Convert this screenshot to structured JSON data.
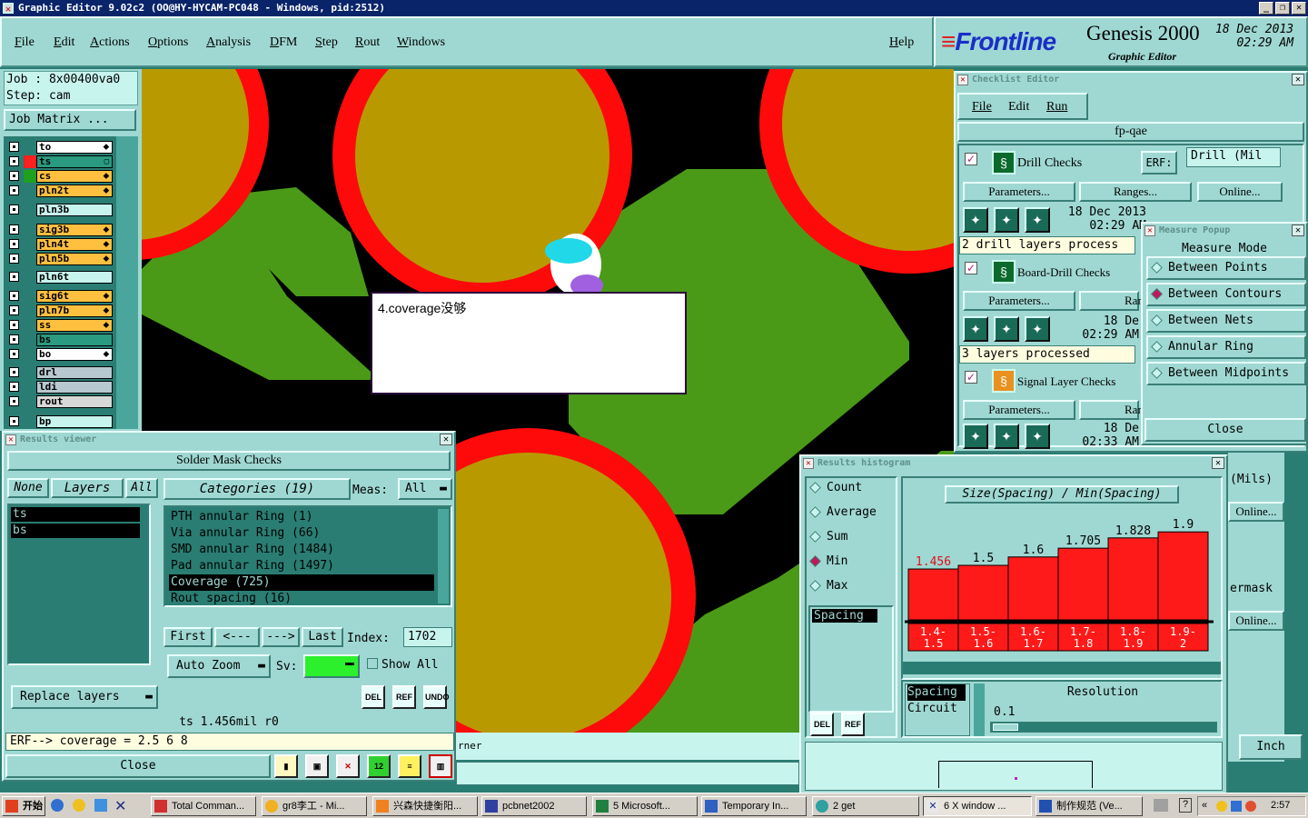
{
  "window": {
    "title": "Graphic Editor 9.02c2 (OO@HY-HYCAM-PC048 - Windows, pid:2512)"
  },
  "menu": [
    "File",
    "Edit",
    "Actions",
    "Options",
    "Analysis",
    "DFM",
    "Step",
    "Rout",
    "Windows"
  ],
  "help": "Help",
  "brand": {
    "logo": "Frontline",
    "product": "Genesis 2000",
    "subtitle": "Graphic Editor",
    "date": "18 Dec 2013",
    "time": "02:29 AM"
  },
  "job": {
    "job_line": "Job : 8x00400va0",
    "step_line": "Step: cam",
    "matrix_button": "Job Matrix ..."
  },
  "layers": [
    {
      "name": "to",
      "color": "#ffffff",
      "swatch": "#2a7d73",
      "mark": "⬥"
    },
    {
      "name": "ts",
      "color": "#2a9a80",
      "swatch": "#ff2020",
      "mark": "▢",
      "active": true
    },
    {
      "name": "cs",
      "color": "#ffc040",
      "swatch": "#1fa01f",
      "mark": "⬥"
    },
    {
      "name": "pln2t",
      "color": "#ffc040",
      "swatch": "#2a7d73",
      "mark": "⬥"
    },
    {
      "name": "pln3b",
      "color": "#c8f4ee",
      "swatch": "#2a7d73",
      "mark": ""
    },
    {
      "name": "sig3b",
      "color": "#ffc040",
      "swatch": "#2a7d73",
      "mark": "⬥"
    },
    {
      "name": "pln4t",
      "color": "#ffc040",
      "swatch": "#2a7d73",
      "mark": "⬥"
    },
    {
      "name": "pln5b",
      "color": "#ffc040",
      "swatch": "#2a7d73",
      "mark": "⬥"
    },
    {
      "name": "pln6t",
      "color": "#c8f4ee",
      "swatch": "#2a7d73",
      "mark": ""
    },
    {
      "name": "sig6t",
      "color": "#ffc040",
      "swatch": "#2a7d73",
      "mark": "⬥"
    },
    {
      "name": "pln7b",
      "color": "#ffc040",
      "swatch": "#2a7d73",
      "mark": "⬥"
    },
    {
      "name": "ss",
      "color": "#ffc040",
      "swatch": "#2a7d73",
      "mark": "⬥"
    },
    {
      "name": "bs",
      "color": "#2a9a80",
      "swatch": "#2a7d73",
      "mark": ""
    },
    {
      "name": "bo",
      "color": "#ffffff",
      "swatch": "#2a7d73",
      "mark": "⬥"
    },
    {
      "name": "drl",
      "color": "#b8c8d0",
      "swatch": "#2a7d73",
      "mark": ""
    },
    {
      "name": "ldi",
      "color": "#b8c8d0",
      "swatch": "#2a7d73",
      "mark": ""
    },
    {
      "name": "rout",
      "color": "#d8d8d8",
      "swatch": "#2a7d73",
      "mark": ""
    },
    {
      "name": "bp",
      "color": "#c8f4ee",
      "swatch": "#2a7d73",
      "mark": ""
    }
  ],
  "canvas_note": "4.coverage没够",
  "results_viewer": {
    "title": "Results viewer",
    "heading": "Solder Mask Checks",
    "none_btn": "None",
    "layers_btn": "Layers",
    "all_btn": "All",
    "layer_items": [
      "ts",
      "bs"
    ],
    "categories_label": "Categories (19)",
    "meas_label": "Meas:",
    "meas_value": "All",
    "categories": [
      "PTH annular Ring (1)",
      "Via annular Ring (66)",
      "SMD annular Ring (1484)",
      "Pad annular Ring (1497)",
      "Coverage (725)",
      "Rout spacing (16)"
    ],
    "selected_category": "Coverage (725)",
    "first": "First",
    "prev": "<---",
    "next": "--->",
    "last": "Last",
    "index_label": "Index:",
    "index_value": "1702",
    "auto_zoom": "Auto Zoom",
    "sv_label": "Sv:",
    "show_all": "Show All",
    "replace_layers": "Replace layers",
    "status": "ts 1.456mil  r0",
    "erf": "ERF--> coverage = 2.5 6 8",
    "close": "Close",
    "tools": [
      "DEL",
      "REF",
      "UNDO"
    ]
  },
  "canvas_status": "rner",
  "checklist": {
    "title": "Checklist Editor",
    "menu": [
      "File",
      "Edit",
      "Run"
    ],
    "name": "fp-qae",
    "sections": [
      {
        "name": "Drill Checks",
        "erf_label": "ERF:",
        "erf_value": "Drill (Mil",
        "date": "18 Dec 2013",
        "time": "02:29 AM",
        "summary": "2 drill layers process"
      },
      {
        "name": "Board-Drill Checks",
        "date": "18 De",
        "time": "02:29 AM",
        "summary": "3 layers processed"
      },
      {
        "name": "Signal Layer Checks",
        "date": "18 De",
        "time": "02:33 AM",
        "summary": ""
      }
    ],
    "params_btn": "Parameters...",
    "ranges_btn": "Ranges...",
    "ranges_short": "Rang",
    "online_btn": "Online...",
    "right_fragments": [
      "(Mils)",
      "Online...",
      "ermask",
      "Online..."
    ],
    "units_btn": "Inch"
  },
  "measure": {
    "title": "Measure Popup",
    "mode_label": "Measure Mode",
    "modes": [
      "Between Points",
      "Between Contours",
      "Between Nets",
      "Annular Ring",
      "Between Midpoints"
    ],
    "selected": "Between Contours",
    "close": "Close"
  },
  "histogram": {
    "title": "Results histogram",
    "stats": [
      "Count",
      "Average",
      "Sum",
      "Min",
      "Max"
    ],
    "selected_stat": "Min",
    "list_item": "Spacing",
    "chart_title": "Size(Spacing) / Min(Spacing)",
    "types": [
      "Spacing",
      "Circuit"
    ],
    "resolution_label": "Resolution",
    "resolution_value": "0.1",
    "tools": [
      "DEL",
      "REF"
    ]
  },
  "chart_data": {
    "type": "bar",
    "title": "Size(Spacing) / Min(Spacing)",
    "categories": [
      "1.4-1.5",
      "1.5-1.6",
      "1.6-1.7",
      "1.7-1.8",
      "1.8-1.9",
      "1.9-2"
    ],
    "values": [
      1.456,
      1.5,
      1.6,
      1.705,
      1.828,
      1.9
    ],
    "value_labels": [
      "1.456",
      "1.5",
      "1.6",
      "1.705",
      "1.828",
      "1.9"
    ],
    "ylim": [
      0,
      2.0
    ],
    "colors": {
      "bar": "#ff1a1a",
      "first_label": "#e0101a"
    }
  },
  "taskbar": {
    "start": "开始",
    "items": [
      "Total Comman...",
      "gr8李工 - Mi...",
      "兴森快捷衡阳...",
      "pcbnet2002",
      "5 Microsoft...",
      "Temporary In...",
      "2 get",
      "6 X window ...",
      "制作规范 (Ve..."
    ],
    "clock": "2:57"
  }
}
